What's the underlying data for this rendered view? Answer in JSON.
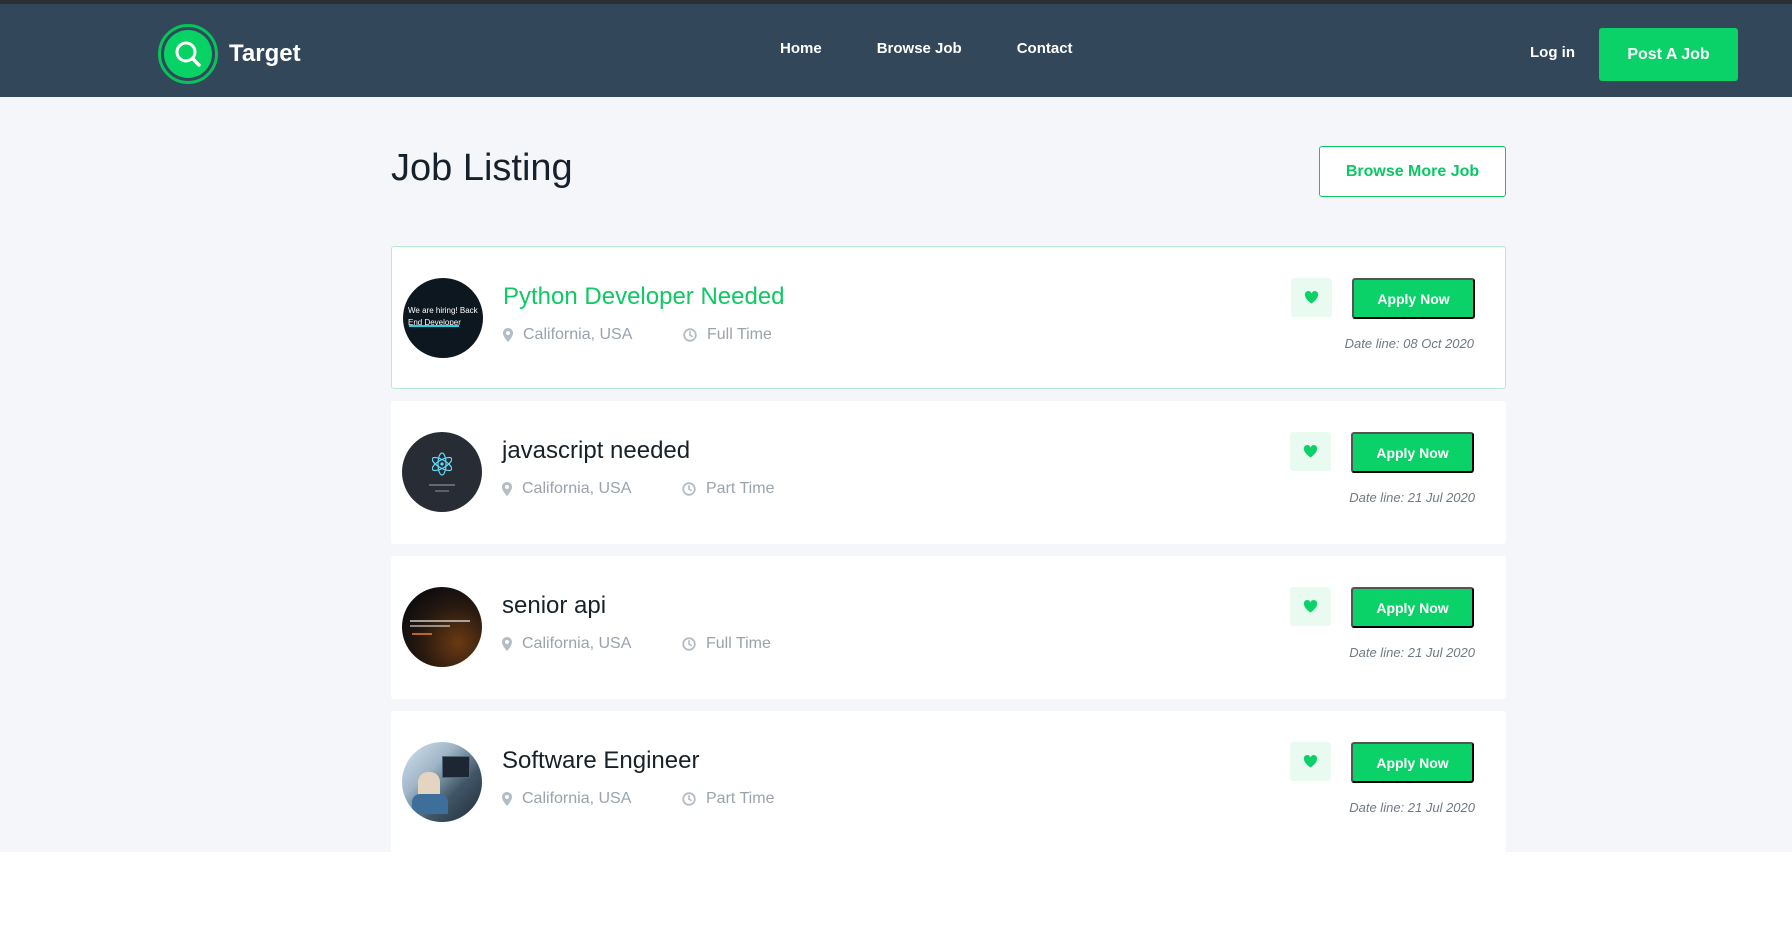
{
  "header": {
    "brand": "Target",
    "nav": [
      "Home",
      "Browse Job",
      "Contact"
    ],
    "login_label": "Log in",
    "post_job_label": "Post A Job"
  },
  "main": {
    "title": "Job Listing",
    "browse_more_label": "Browse More Job",
    "jobs": [
      {
        "title": "Python Developer Needed",
        "location": "California, USA",
        "type": "Full Time",
        "deadline": "Date line: 08 Oct 2020",
        "apply_label": "Apply Now",
        "logo_text": "We are hiring! Back End Developer"
      },
      {
        "title": "javascript needed",
        "location": "California, USA",
        "type": "Part Time",
        "deadline": "Date line: 21 Jul 2020",
        "apply_label": "Apply Now"
      },
      {
        "title": "senior api",
        "location": "California, USA",
        "type": "Full Time",
        "deadline": "Date line: 21 Jul 2020",
        "apply_label": "Apply Now"
      },
      {
        "title": "Software Engineer",
        "location": "California, USA",
        "type": "Part Time",
        "deadline": "Date line: 21 Jul 2020",
        "apply_label": "Apply Now"
      }
    ]
  },
  "icons": {
    "brand_logo": "magnifier-icon",
    "location": "map-pin-icon",
    "job_type": "clock-icon",
    "favorite": "heart-icon"
  },
  "colors": {
    "navbar": "#33475b",
    "accent": "#0bd268",
    "page_background": "#f4f6fa",
    "active_title": "#10c864"
  }
}
